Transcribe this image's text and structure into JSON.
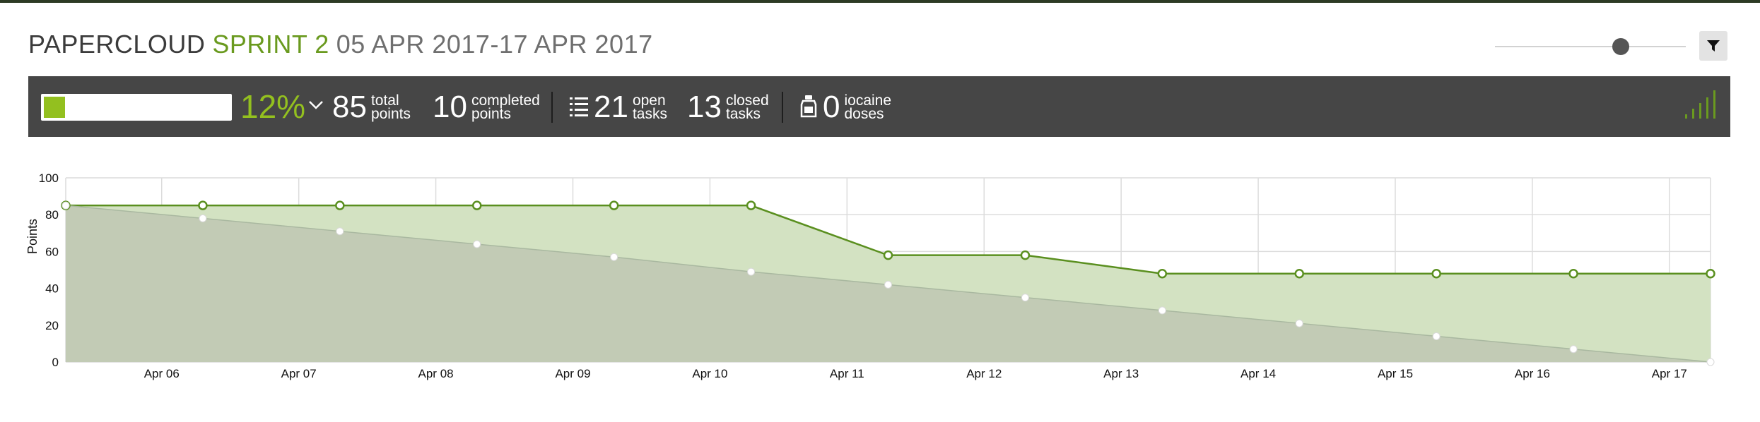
{
  "header": {
    "project": "PAPERCLOUD",
    "sprint": "SPRINT 2",
    "dates": "05 APR 2017-17 APR 2017",
    "filter_icon": "funnel-icon",
    "zoom_slider_level": 0.66
  },
  "summary": {
    "progress_fraction": 0.12,
    "percent": "12%",
    "total_points": "85",
    "total_label_1": "total",
    "total_label_2": "points",
    "completed_points": "10",
    "completed_label_1": "completed",
    "completed_label_2": "points",
    "open_tasks": "21",
    "open_label_1": "open",
    "open_label_2": "tasks",
    "closed_tasks": "13",
    "closed_label_1": "closed",
    "closed_label_2": "tasks",
    "iocaine_doses": "0",
    "iocaine_label_1": "iocaine",
    "iocaine_label_2": "doses",
    "colors": {
      "accent": "#93c01f",
      "bar_bg": "#464646"
    }
  },
  "chart_data": {
    "type": "area",
    "ylabel": "Points",
    "ylim": [
      0,
      100
    ],
    "yticks": [
      0,
      20,
      40,
      60,
      80,
      100
    ],
    "xtick_labels": [
      "Apr 06",
      "Apr 07",
      "Apr 08",
      "Apr 09",
      "Apr 10",
      "Apr 11",
      "Apr 12",
      "Apr 13",
      "Apr 14",
      "Apr 15",
      "Apr 16",
      "Apr 17"
    ],
    "grid": true,
    "series": [
      {
        "key": "remaining",
        "color": "#5a8f1f",
        "fill": "#d3e2c2",
        "values": [
          85,
          85,
          85,
          85,
          85,
          85,
          58,
          58,
          48,
          48,
          48,
          48,
          48
        ]
      },
      {
        "key": "ideal",
        "color": "#a9b8a0",
        "fill": "#bec7b3",
        "values": [
          85,
          78,
          71,
          64,
          57,
          49,
          42,
          35,
          28,
          21,
          14,
          7,
          0
        ]
      }
    ]
  }
}
